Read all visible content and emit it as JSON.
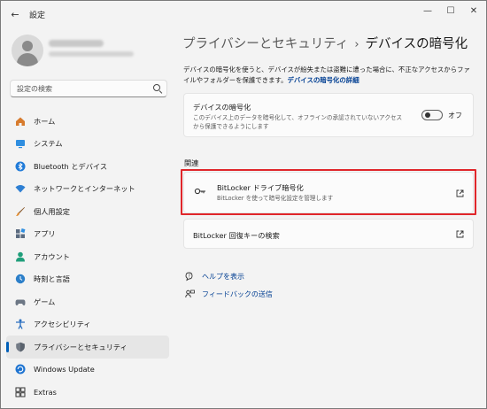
{
  "window": {
    "title": "設定",
    "back_glyph": "←",
    "minimize_glyph": "—",
    "maximize_glyph": "☐",
    "close_glyph": "✕"
  },
  "sidebar": {
    "search_placeholder": "設定の検索",
    "items": [
      {
        "label": "ホーム",
        "icon": "home-icon"
      },
      {
        "label": "システム",
        "icon": "system-icon"
      },
      {
        "label": "Bluetooth とデバイス",
        "icon": "bluetooth-icon"
      },
      {
        "label": "ネットワークとインターネット",
        "icon": "network-icon"
      },
      {
        "label": "個人用設定",
        "icon": "brush-icon"
      },
      {
        "label": "アプリ",
        "icon": "apps-icon"
      },
      {
        "label": "アカウント",
        "icon": "account-icon"
      },
      {
        "label": "時刻と言語",
        "icon": "time-language-icon"
      },
      {
        "label": "ゲーム",
        "icon": "gaming-icon"
      },
      {
        "label": "アクセシビリティ",
        "icon": "accessibility-icon"
      },
      {
        "label": "プライバシーとセキュリティ",
        "icon": "shield-icon",
        "active": true
      },
      {
        "label": "Windows Update",
        "icon": "windows-update-icon"
      },
      {
        "label": "Extras",
        "icon": "extras-icon"
      }
    ]
  },
  "main": {
    "breadcrumb_parent": "プライバシーとセキュリティ",
    "breadcrumb_sep": "›",
    "breadcrumb_current": "デバイスの暗号化",
    "description": "デバイスの暗号化を使うと、デバイスが紛失または盗難に遭った場合に、不正なアクセスからファイルやフォルダーを保護できます。",
    "description_link": "デバイスの暗号化の詳細",
    "encryption_card": {
      "title": "デバイスの暗号化",
      "subtitle": "このデバイス上のデータを暗号化して、オフラインの承認されていないアクセスから保護できるようにします",
      "toggle_label": "オフ"
    },
    "section_related": "関連",
    "bitlocker_card": {
      "title": "BitLocker ドライブ暗号化",
      "subtitle": "BitLocker を使って暗号化設定を管理します"
    },
    "recovery_card": {
      "title": "BitLocker 回復キーの検索"
    },
    "help_link": "ヘルプを表示",
    "feedback_link": "フィードバックの送信"
  },
  "colors": {
    "accent": "#005fb8",
    "link": "#003e92",
    "highlight": "#e0262a"
  }
}
